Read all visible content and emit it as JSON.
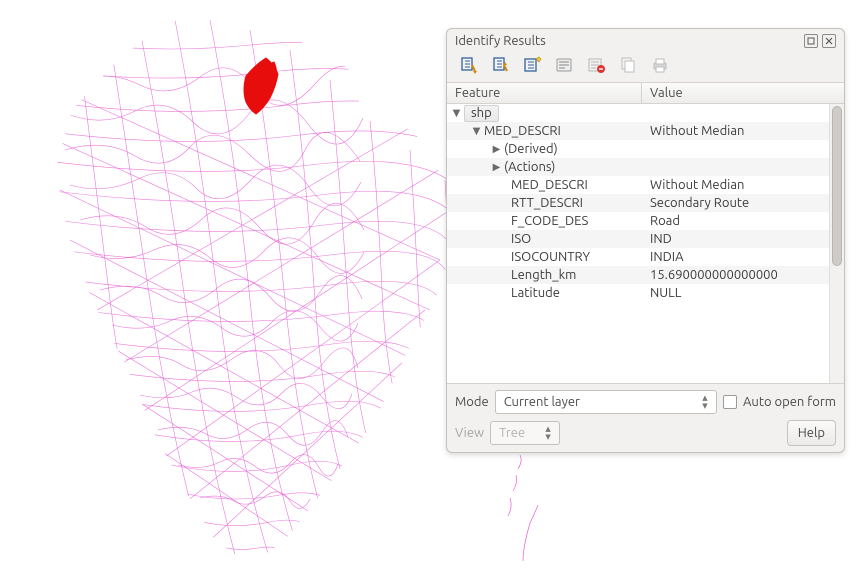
{
  "panel": {
    "title": "Identify Results",
    "columns": {
      "feature": "Feature",
      "value": "Value"
    },
    "tree": {
      "layer": "shp",
      "feature_label": "MED_DESCRI",
      "feature_value": "Without Median",
      "derived_label": "(Derived)",
      "actions_label": "(Actions)",
      "attrs": [
        {
          "k": "MED_DESCRI",
          "v": "Without Median"
        },
        {
          "k": "RTT_DESCRI",
          "v": "Secondary Route"
        },
        {
          "k": "F_CODE_DES",
          "v": "Road"
        },
        {
          "k": "ISO",
          "v": "IND"
        },
        {
          "k": "ISOCOUNTRY",
          "v": "INDIA"
        },
        {
          "k": "Length_km",
          "v": "15.690000000000000"
        },
        {
          "k": "Latitude",
          "v": "NULL"
        }
      ]
    },
    "mode_label": "Mode",
    "mode_value": "Current layer",
    "auto_open_label": "Auto open form",
    "view_label": "View",
    "view_value": "Tree",
    "help_label": "Help"
  },
  "toolbar_icons": [
    "expand-tree-icon",
    "collapse-tree-icon",
    "expand-new-icon",
    "form-view-icon",
    "clear-results-icon",
    "copy-icon",
    "print-icon"
  ]
}
